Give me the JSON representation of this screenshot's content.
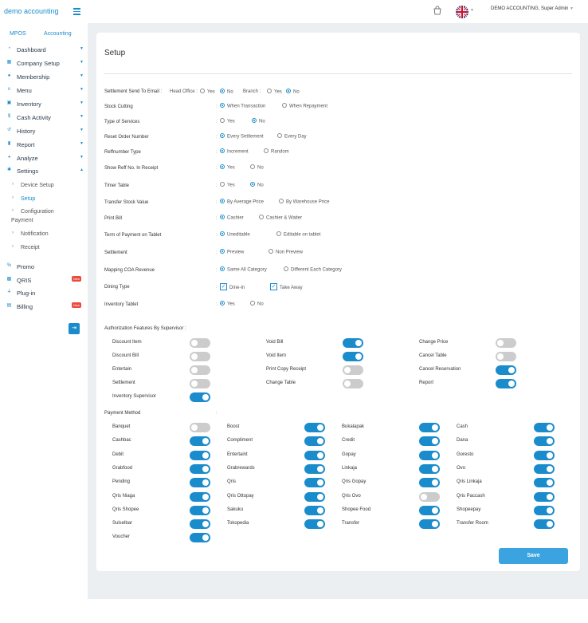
{
  "header": {
    "brand": "demo accounting",
    "user": "DEMO ACCOUNTING, Super Admin"
  },
  "sidebar": {
    "tabs": [
      "MPOS",
      "Accounting"
    ],
    "items": [
      {
        "label": "Dashboard",
        "icon": "gauge-icon",
        "caret": true
      },
      {
        "label": "Company Setup",
        "icon": "building-icon",
        "caret": true
      },
      {
        "label": "Membership",
        "icon": "users-icon",
        "caret": true
      },
      {
        "label": "Menu",
        "icon": "utensils-icon",
        "caret": true
      },
      {
        "label": "Inventory",
        "icon": "box-icon",
        "caret": true
      },
      {
        "label": "Cash Activity",
        "icon": "dollar-icon",
        "caret": true
      },
      {
        "label": "History",
        "icon": "history-icon",
        "caret": true
      },
      {
        "label": "Report",
        "icon": "file-icon",
        "caret": true
      },
      {
        "label": "Analyze",
        "icon": "chart-icon",
        "caret": true
      },
      {
        "label": "Settings",
        "icon": "gear-icon",
        "caret": true
      }
    ],
    "settings_sub": [
      "Device Setup",
      "Setup",
      "Configuration Payment",
      "Notification",
      "Receipt"
    ],
    "extra": [
      {
        "label": "Promo",
        "icon": "percent-icon",
        "badge": ""
      },
      {
        "label": "QRIS",
        "icon": "qr-icon",
        "badge": "New"
      },
      {
        "label": "Plug-in",
        "icon": "plug-icon",
        "badge": ""
      },
      {
        "label": "Billing",
        "icon": "invoice-icon",
        "badge": "New"
      }
    ]
  },
  "setup": {
    "title": "Setup",
    "settlement": {
      "label": "Settlement Send To Email :",
      "head_office": "Head Office :",
      "branch": "Branch :",
      "yes": "Yes",
      "no": "No"
    },
    "rows": [
      {
        "label": "Stock Cutting",
        "options": [
          "When Transaction",
          "When Repayment"
        ],
        "selected": 0
      },
      {
        "label": "Type of Services",
        "options": [
          "Yes",
          "No"
        ],
        "selected": 1
      },
      {
        "label": "Reset Order Number",
        "options": [
          "Every Settlement",
          "Every Day"
        ],
        "selected": 0
      },
      {
        "label": "Reffnumber Type",
        "options": [
          "Increment",
          "Random"
        ],
        "selected": 0
      },
      {
        "label": "Show Reff No. In Receipt",
        "options": [
          "Yes",
          "No"
        ],
        "selected": 0
      },
      {
        "label": "Timer Table",
        "options": [
          "Yes",
          "No"
        ],
        "selected": 1
      },
      {
        "label": "Transfer Stock Value",
        "options": [
          "By Average Price",
          "By Warehouse Price"
        ],
        "selected": 0
      },
      {
        "label": "Print Bill",
        "options": [
          "Cashier",
          "Cashier & Waiter"
        ],
        "selected": 0
      },
      {
        "label": "Term of Payment on Tablet",
        "options": [
          "Uneditable",
          "Editable on tablet"
        ],
        "selected": 0
      },
      {
        "label": "Settlement",
        "options": [
          "Preview",
          "Non Preview"
        ],
        "selected": 0
      },
      {
        "label": "Mapping COA Revenue",
        "options": [
          "Same All Category",
          "Different Each Category"
        ],
        "selected": 0
      },
      {
        "label": "Dining Type",
        "options": [
          "Dine-In",
          "Take Away"
        ],
        "checkbox": true
      },
      {
        "label": "Inventory Tablet",
        "options": [
          "Yes",
          "No"
        ],
        "selected": 0
      }
    ],
    "auth_title": "Authorization Features By Supervisor :",
    "auth": [
      {
        "label": "Discount Item",
        "on": false
      },
      {
        "label": "Void Bill",
        "on": true
      },
      {
        "label": "Change Price",
        "on": false
      },
      {
        "label": "Discount Bill",
        "on": false
      },
      {
        "label": "Void Item",
        "on": true
      },
      {
        "label": "Cancel Table",
        "on": false
      },
      {
        "label": "Entertain",
        "on": false
      },
      {
        "label": "Print Copy Receipt",
        "on": false
      },
      {
        "label": "Cancel Reservation",
        "on": true
      },
      {
        "label": "Settlement",
        "on": false
      },
      {
        "label": "Change Table",
        "on": false
      },
      {
        "label": "Report",
        "on": true
      },
      {
        "label": "Inventory Supervisor",
        "on": true
      }
    ],
    "payment_title": "Payment Method",
    "payments": [
      {
        "label": "Banquet",
        "on": false
      },
      {
        "label": "Boost",
        "on": true
      },
      {
        "label": "Bukalapak",
        "on": true
      },
      {
        "label": "Cash",
        "on": true
      },
      {
        "label": "Cashbac",
        "on": true
      },
      {
        "label": "Compliment",
        "on": true
      },
      {
        "label": "Credit",
        "on": true
      },
      {
        "label": "Dana",
        "on": true
      },
      {
        "label": "Debit",
        "on": true
      },
      {
        "label": "Entertaint",
        "on": true
      },
      {
        "label": "Gopay",
        "on": true
      },
      {
        "label": "Goresto",
        "on": true
      },
      {
        "label": "Grabfood",
        "on": true
      },
      {
        "label": "Grabrewards",
        "on": true
      },
      {
        "label": "Linkaja",
        "on": true
      },
      {
        "label": "Ovo",
        "on": true
      },
      {
        "label": "Pending",
        "on": true
      },
      {
        "label": "Qris",
        "on": true
      },
      {
        "label": "Qris Gopay",
        "on": true
      },
      {
        "label": "Qris Linkaja",
        "on": true
      },
      {
        "label": "Qris Niaga",
        "on": true
      },
      {
        "label": "Qris Ottopay",
        "on": true
      },
      {
        "label": "Qris Ovo",
        "on": false
      },
      {
        "label": "Qris Paccash",
        "on": true
      },
      {
        "label": "Qris Shopee",
        "on": true
      },
      {
        "label": "Sakuku",
        "on": true
      },
      {
        "label": "Shopee Food",
        "on": true
      },
      {
        "label": "Shopeepay",
        "on": true
      },
      {
        "label": "Sulselbar",
        "on": true
      },
      {
        "label": "Tokopedia",
        "on": true
      },
      {
        "label": "Transfer",
        "on": true
      },
      {
        "label": "Transfer Room",
        "on": true
      },
      {
        "label": "Voucher",
        "on": true
      }
    ],
    "save": "Save"
  },
  "colors": {
    "accent": "#1a8ccc",
    "badge": "#e74c3c",
    "bg": "#eceff1"
  }
}
